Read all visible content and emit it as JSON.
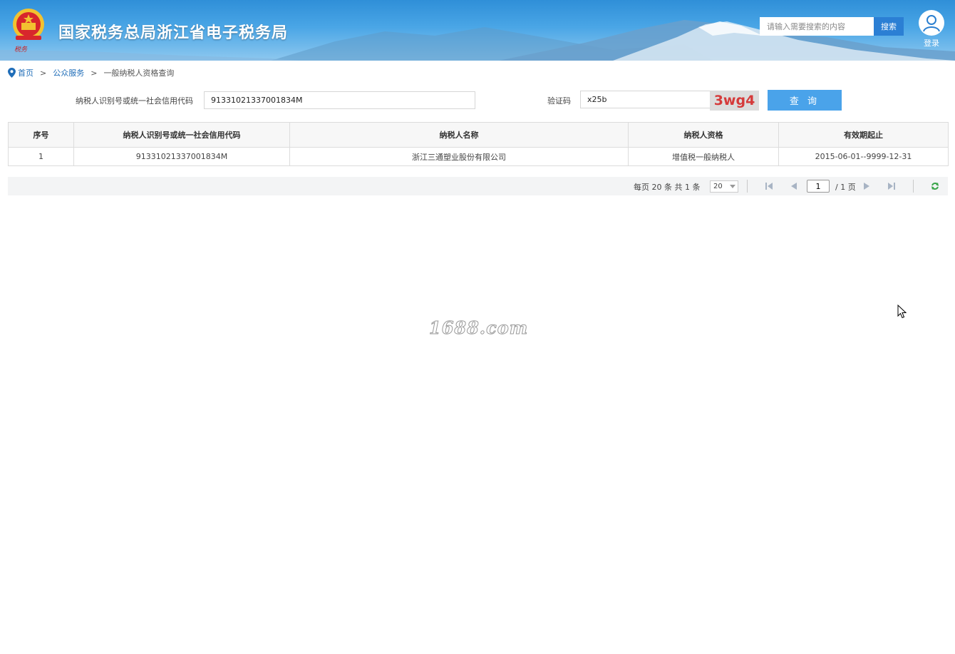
{
  "header": {
    "site_title": "国家税务总局浙江省电子税务局",
    "search_placeholder": "请输入需要搜索的内容",
    "search_button": "搜索",
    "login_label": "登录"
  },
  "breadcrumb": {
    "items": [
      "首页",
      "公众服务",
      "一般纳税人资格查询"
    ],
    "separator": ">"
  },
  "query_form": {
    "taxpayer_id_label": "纳税人识别号或统一社会信用代码",
    "taxpayer_id_value": "91331021337001834M",
    "captcha_label": "验证码",
    "captcha_value": "x25b",
    "captcha_image_text": "3wg4",
    "query_button": "查 询"
  },
  "table": {
    "headers": [
      "序号",
      "纳税人识别号或统一社会信用代码",
      "纳税人名称",
      "纳税人资格",
      "有效期起止"
    ],
    "rows": [
      [
        "1",
        "91331021337001834M",
        "浙江三通塑业股份有限公司",
        "增值税一般纳税人",
        "2015-06-01--9999-12-31"
      ]
    ]
  },
  "pager": {
    "info": "每页 20 条 共 1 条",
    "page_size": "20",
    "current_page": "1",
    "total_pages": "/ 1 页"
  },
  "watermark": "1688.com",
  "colors": {
    "banner": "#3a9be0",
    "link": "#1f6db8",
    "query_button": "#4aa3ea",
    "search_button": "#2b7fd4",
    "captcha_text": "#d53a3a"
  },
  "icons": [
    "emblem-icon",
    "user-icon",
    "location-pin-icon",
    "first-page-icon",
    "prev-page-icon",
    "next-page-icon",
    "last-page-icon",
    "refresh-icon"
  ]
}
